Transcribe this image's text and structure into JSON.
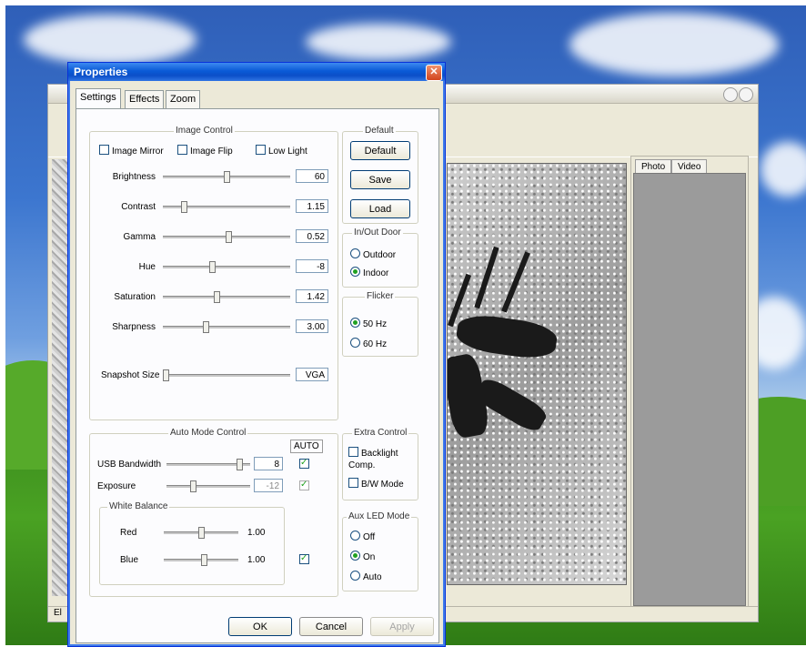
{
  "background_window": {
    "status_text": "El",
    "panel_tabs": [
      "Photo",
      "Video"
    ]
  },
  "dialog": {
    "title": "Properties",
    "tabs": [
      "Settings",
      "Effects",
      "Zoom"
    ],
    "image_control": {
      "legend": "Image Control",
      "image_mirror": "Image Mirror",
      "image_flip": "Image Flip",
      "low_light": "Low Light",
      "sliders": [
        {
          "label": "Brightness",
          "value": "60",
          "position": 0.5
        },
        {
          "label": "Contrast",
          "value": "1.15",
          "position": 0.15
        },
        {
          "label": "Gamma",
          "value": "0.52",
          "position": 0.52
        },
        {
          "label": "Hue",
          "value": "-8",
          "position": 0.38
        },
        {
          "label": "Saturation",
          "value": "1.42",
          "position": 0.42
        },
        {
          "label": "Sharpness",
          "value": "3.00",
          "position": 0.33
        }
      ],
      "snapshot_size_label": "Snapshot Size",
      "snapshot_size_value": "VGA",
      "snapshot_position": 0.0
    },
    "default": {
      "legend": "Default",
      "default_button": "Default",
      "save_button": "Save",
      "load_button": "Load"
    },
    "in_out_door": {
      "legend": "In/Out Door",
      "outdoor": "Outdoor",
      "indoor": "Indoor",
      "selected": "Indoor"
    },
    "flicker": {
      "legend": "Flicker",
      "hz50": "50 Hz",
      "hz60": "60 Hz",
      "selected": "50 Hz"
    },
    "auto_mode_control": {
      "legend": "Auto Mode Control",
      "auto_header": "AUTO",
      "usb_bandwidth_label": "USB Bandwidth",
      "usb_bandwidth_value": "8",
      "usb_position": 0.9,
      "exposure_label": "Exposure",
      "exposure_value": "-12",
      "exposure_position": 0.3,
      "white_balance": {
        "legend": "White Balance",
        "red_label": "Red",
        "red_value": "1.00",
        "red_position": 0.5,
        "blue_label": "Blue",
        "blue_value": "1.00",
        "blue_position": 0.55
      }
    },
    "extra_control": {
      "legend": "Extra Control",
      "backlight_comp": "Backlight Comp.",
      "bw_mode": "B/W Mode"
    },
    "aux_led_mode": {
      "legend": "Aux LED Mode",
      "off": "Off",
      "on": "On",
      "auto": "Auto",
      "selected": "On"
    },
    "footer": {
      "ok": "OK",
      "cancel": "Cancel",
      "apply": "Apply"
    }
  }
}
